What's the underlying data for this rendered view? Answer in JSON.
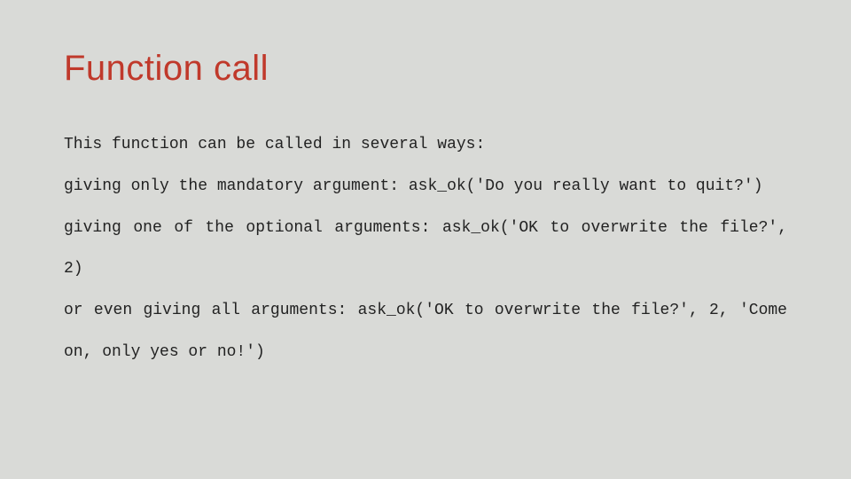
{
  "slide": {
    "title": "Function call",
    "paragraphs": [
      "This function can be called in several ways:",
      "giving only the mandatory argument: ask_ok('Do you really want to quit?')",
      "giving one of the optional arguments: ask_ok('OK to overwrite the file?', 2)",
      "or even giving all arguments: ask_ok('OK to overwrite the file?', 2, 'Come on, only yes or no!')"
    ]
  }
}
